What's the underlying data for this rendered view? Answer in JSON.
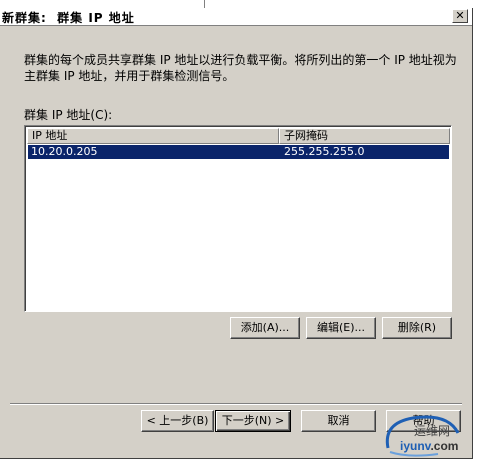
{
  "dialog": {
    "title": "新群集:  群集 IP 地址",
    "close_glyph": "✕",
    "description": "群集的每个成员共享群集 IP 地址以进行负载平衡。将所列出的第一个 IP 地址视为主群集 IP 地址，并用于群集检测信号。",
    "list_label": "群集 IP 地址(C):"
  },
  "table": {
    "columns": [
      "IP 地址",
      "子网掩码"
    ],
    "rows": [
      {
        "ip": "10.20.0.205",
        "mask": "255.255.255.0",
        "selected": true
      }
    ]
  },
  "buttons": {
    "add": "添加(A)...",
    "edit": "编辑(E)...",
    "delete": "删除(R)",
    "back": "< 上一步(B)",
    "next": "下一步(N) >",
    "cancel": "取消",
    "help": "帮助"
  },
  "watermark": {
    "text_prefix": "iyunv",
    "text_suffix": ".com",
    "top_text": "运维网"
  },
  "colors": {
    "dialog_bg": "#d4d0c8",
    "selection": "#0a246a",
    "watermark_blue": "#1e5fb4"
  }
}
